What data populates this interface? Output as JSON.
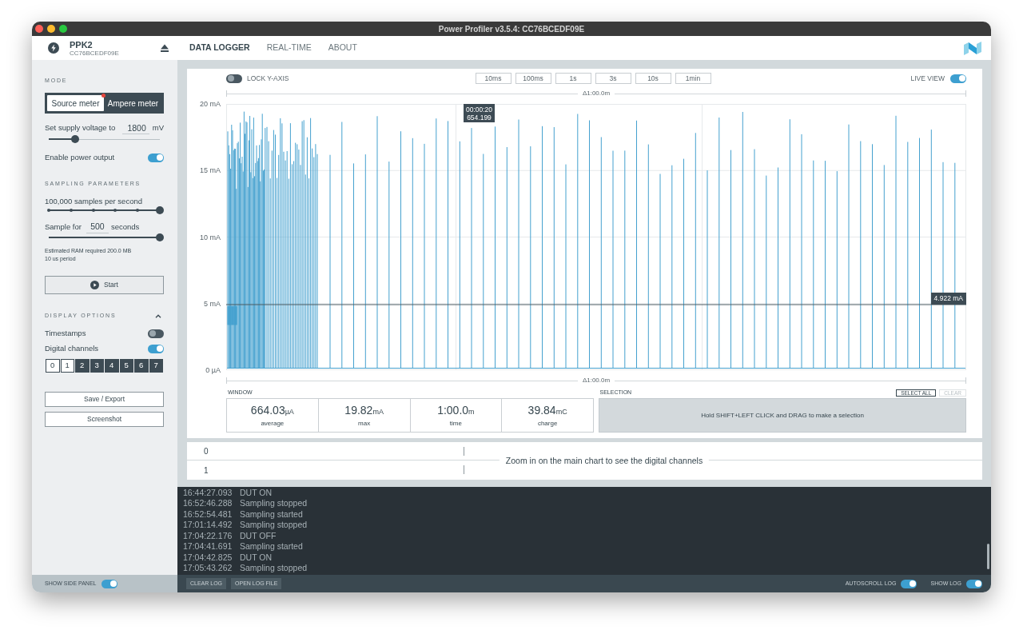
{
  "window": {
    "title": "Power Profiler v3.5.4: CC76BCEDF09E"
  },
  "device": {
    "name": "PPK2",
    "serial": "CC76BCEDF09E"
  },
  "tabs": [
    {
      "label": "DATA LOGGER",
      "selected": true
    },
    {
      "label": "REAL-TIME",
      "selected": false
    },
    {
      "label": "ABOUT",
      "selected": false
    }
  ],
  "sidebar": {
    "mode": {
      "heading": "MODE",
      "options": [
        {
          "label": "Source meter",
          "selected": true,
          "notification": true
        },
        {
          "label": "Ampere meter",
          "selected": false,
          "notification": false
        }
      ]
    },
    "voltage": {
      "label": "Set supply voltage to",
      "value": "1800",
      "unit": "mV",
      "level": 0.24
    },
    "power_output": {
      "label": "Enable power output",
      "on": true
    },
    "sampling": {
      "heading": "SAMPLING PARAMETERS",
      "rate": {
        "label": "100,000 samples per second",
        "level": 1
      },
      "duration": {
        "label_before": "Sample for",
        "value": "500",
        "label_after": "seconds",
        "level": 1
      },
      "notes": [
        "Estimated RAM required 200.0 MB",
        "10 us period"
      ]
    },
    "start_button": "Start",
    "display": {
      "heading": "DISPLAY OPTIONS",
      "expanded": true,
      "toggles": [
        {
          "label": "Timestamps",
          "on": false
        },
        {
          "label": "Digital channels",
          "on": true
        }
      ],
      "channels": [
        {
          "label": "0",
          "selected": true
        },
        {
          "label": "1",
          "selected": true
        },
        {
          "label": "2",
          "selected": false
        },
        {
          "label": "3",
          "selected": false
        },
        {
          "label": "4",
          "selected": false
        },
        {
          "label": "5",
          "selected": false
        },
        {
          "label": "6",
          "selected": false
        },
        {
          "label": "7",
          "selected": false
        }
      ]
    },
    "buttons": [
      "Save / Export",
      "Screenshot"
    ],
    "show_side_panel": {
      "label": "SHOW SIDE PANEL",
      "on": true
    }
  },
  "chart": {
    "lock_y_axis": {
      "label": "LOCK Y-AXIS",
      "on": false
    },
    "zoom_buttons": [
      "10ms",
      "100ms",
      "1s",
      "3s",
      "10s",
      "1min"
    ],
    "live_view": {
      "label": "LIVE VIEW",
      "on": true
    },
    "span_top": "Δ1:00.0m",
    "y_ticks": [
      "20 mA",
      "15 mA",
      "10 mA",
      "5 mA",
      "0 µA"
    ],
    "cursor": {
      "time": "00:00:20",
      "value": "654.199"
    },
    "marker": "4.922 mA",
    "span_bottom": "Δ1:00.0m"
  },
  "window_stats": {
    "heading": "WINDOW",
    "items": [
      {
        "value": "664.03",
        "unit": "µA",
        "label": "average"
      },
      {
        "value": "19.82",
        "unit": "mA",
        "label": "max"
      },
      {
        "value": "1:00.0",
        "unit": "m",
        "label": "time"
      },
      {
        "value": "39.84",
        "unit": "mC",
        "label": "charge"
      }
    ]
  },
  "selection": {
    "heading": "SELECTION",
    "buttons": [
      {
        "label": "SELECT ALL",
        "disabled": false
      },
      {
        "label": "CLEAR",
        "disabled": true
      }
    ],
    "hint": "Hold SHIFT+LEFT CLICK and DRAG to make a selection"
  },
  "digital_channels": {
    "rows": [
      "0",
      "1"
    ],
    "message": "Zoom in on the main chart to see the digital channels"
  },
  "log": {
    "entries": [
      {
        "time": "16:44:27.093",
        "message": "DUT ON"
      },
      {
        "time": "16:52:46.288",
        "message": "Sampling stopped"
      },
      {
        "time": "16:52:54.481",
        "message": "Sampling started"
      },
      {
        "time": "17:01:14.492",
        "message": "Sampling stopped"
      },
      {
        "time": "17:04:22.176",
        "message": "DUT OFF"
      },
      {
        "time": "17:04:41.691",
        "message": "Sampling started"
      },
      {
        "time": "17:04:42.825",
        "message": "DUT ON"
      },
      {
        "time": "17:05:43.262",
        "message": "Sampling stopped"
      }
    ],
    "buttons": [
      "CLEAR LOG",
      "OPEN LOG FILE"
    ],
    "toggles": [
      {
        "label": "AUTOSCROLL LOG",
        "on": true
      },
      {
        "label": "SHOW LOG",
        "on": true
      }
    ]
  }
}
